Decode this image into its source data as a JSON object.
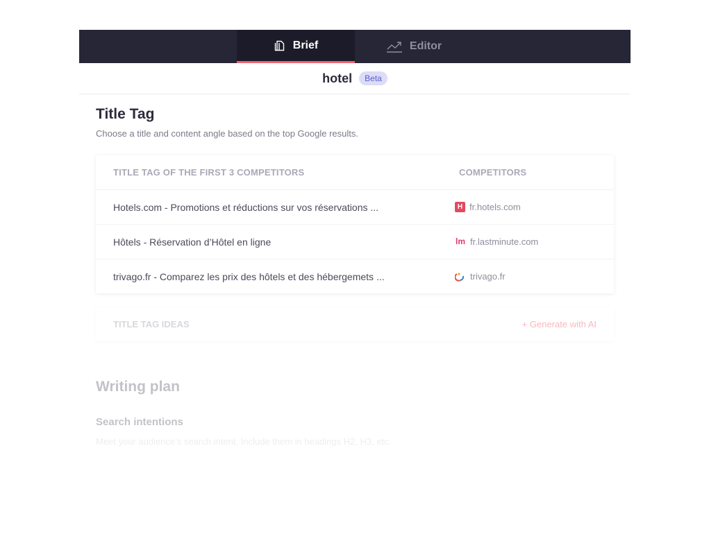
{
  "tabs": {
    "brief": {
      "label": "Brief",
      "icon": "document-icon",
      "active": true
    },
    "editor": {
      "label": "Editor",
      "icon": "trend-chart-icon",
      "active": false
    }
  },
  "keyword": {
    "text": "hotel",
    "badge": "Beta"
  },
  "title_tag": {
    "heading": "Title Tag",
    "description": "Choose a title and content angle based on the top Google results.",
    "table": {
      "headers": [
        "TITLE TAG OF THE FIRST 3 COMPETITORS",
        "COMPETITORS"
      ],
      "rows": [
        {
          "title": "Hotels.com - Promotions et réductions sur vos réservations ...",
          "domain": "fr.hotels.com",
          "favicon": "hotels-favicon"
        },
        {
          "title": "Hôtels - Réservation d’Hôtel en ligne",
          "domain": "fr.lastminute.com",
          "favicon": "lastminute-favicon"
        },
        {
          "title": "trivago.fr - Comparez les prix des hôtels et des hébergemets ...",
          "domain": "trivago.fr",
          "favicon": "trivago-favicon"
        }
      ]
    },
    "ideas": {
      "label": "TITLE TAG IDEAS",
      "action": "+ Generate with AI"
    }
  },
  "writing_plan": {
    "heading": "Writing plan",
    "search_intentions": {
      "heading": "Search intentions",
      "description": "Meet your audience’s search intent. Include them in headings H2, H3, etc."
    }
  },
  "colors": {
    "topbar": "#262637",
    "active_tab": "#1b1b29",
    "accent": "#f2616e",
    "badge_bg": "#dcdcf7",
    "badge_text": "#5a5fc8"
  }
}
